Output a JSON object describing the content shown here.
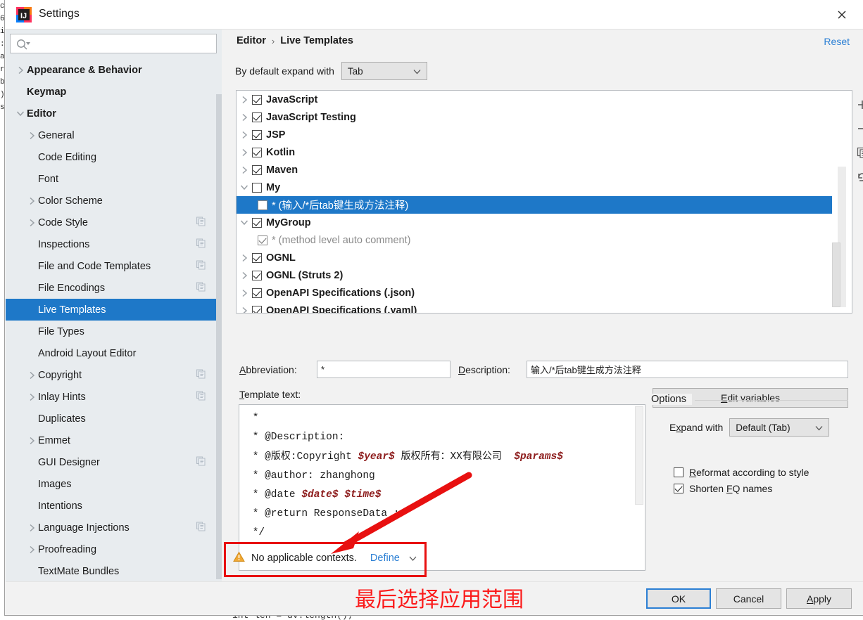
{
  "window": {
    "title": "Settings",
    "logo_icon": "intellij-idea-logo",
    "close_icon": "close-icon"
  },
  "sidebar": {
    "search": {
      "placeholder": "",
      "value": "",
      "icon": "search-icon"
    },
    "items": [
      {
        "label": "Appearance & Behavior",
        "level": 0,
        "arrow": "chevron-right",
        "selected": false,
        "copy": false
      },
      {
        "label": "Keymap",
        "level": 0,
        "arrow": "none",
        "selected": false,
        "copy": false
      },
      {
        "label": "Editor",
        "level": 0,
        "arrow": "chevron-down",
        "selected": false,
        "copy": false
      },
      {
        "label": "General",
        "level": 1,
        "arrow": "chevron-right",
        "selected": false,
        "copy": false
      },
      {
        "label": "Code Editing",
        "level": 1,
        "arrow": "none",
        "selected": false,
        "copy": false
      },
      {
        "label": "Font",
        "level": 1,
        "arrow": "none",
        "selected": false,
        "copy": false
      },
      {
        "label": "Color Scheme",
        "level": 1,
        "arrow": "chevron-right",
        "selected": false,
        "copy": false
      },
      {
        "label": "Code Style",
        "level": 1,
        "arrow": "chevron-right",
        "selected": false,
        "copy": true
      },
      {
        "label": "Inspections",
        "level": 1,
        "arrow": "none",
        "selected": false,
        "copy": true
      },
      {
        "label": "File and Code Templates",
        "level": 1,
        "arrow": "none",
        "selected": false,
        "copy": true
      },
      {
        "label": "File Encodings",
        "level": 1,
        "arrow": "none",
        "selected": false,
        "copy": true
      },
      {
        "label": "Live Templates",
        "level": 1,
        "arrow": "none",
        "selected": true,
        "copy": false
      },
      {
        "label": "File Types",
        "level": 1,
        "arrow": "none",
        "selected": false,
        "copy": false
      },
      {
        "label": "Android Layout Editor",
        "level": 1,
        "arrow": "none",
        "selected": false,
        "copy": false
      },
      {
        "label": "Copyright",
        "level": 1,
        "arrow": "chevron-right",
        "selected": false,
        "copy": true
      },
      {
        "label": "Inlay Hints",
        "level": 1,
        "arrow": "chevron-right",
        "selected": false,
        "copy": true
      },
      {
        "label": "Duplicates",
        "level": 1,
        "arrow": "none",
        "selected": false,
        "copy": false
      },
      {
        "label": "Emmet",
        "level": 1,
        "arrow": "chevron-right",
        "selected": false,
        "copy": false
      },
      {
        "label": "GUI Designer",
        "level": 1,
        "arrow": "none",
        "selected": false,
        "copy": true
      },
      {
        "label": "Images",
        "level": 1,
        "arrow": "none",
        "selected": false,
        "copy": false
      },
      {
        "label": "Intentions",
        "level": 1,
        "arrow": "none",
        "selected": false,
        "copy": false
      },
      {
        "label": "Language Injections",
        "level": 1,
        "arrow": "chevron-right",
        "selected": false,
        "copy": true
      },
      {
        "label": "Proofreading",
        "level": 1,
        "arrow": "chevron-right",
        "selected": false,
        "copy": false
      },
      {
        "label": "TextMate Bundles",
        "level": 1,
        "arrow": "none",
        "selected": false,
        "copy": false
      }
    ],
    "help_label": "?"
  },
  "content": {
    "breadcrumb": {
      "parent": "Editor",
      "separator": "›",
      "current": "Live Templates"
    },
    "reset_label": "Reset",
    "expand_row": {
      "label": "By default expand with",
      "value": "Tab"
    },
    "templates": [
      {
        "label": "JavaScript",
        "arrow": "chevron-right",
        "checked": true,
        "child": false,
        "selected": false
      },
      {
        "label": "JavaScript Testing",
        "arrow": "chevron-right",
        "checked": true,
        "child": false,
        "selected": false
      },
      {
        "label": "JSP",
        "arrow": "chevron-right",
        "checked": true,
        "child": false,
        "selected": false
      },
      {
        "label": "Kotlin",
        "arrow": "chevron-right",
        "checked": true,
        "child": false,
        "selected": false
      },
      {
        "label": "Maven",
        "arrow": "chevron-right",
        "checked": true,
        "child": false,
        "selected": false
      },
      {
        "label": "My",
        "arrow": "chevron-down",
        "checked": false,
        "child": false,
        "selected": false
      },
      {
        "label": "* (输入/*后tab键生成方法注释)",
        "arrow": "none",
        "checked": false,
        "child": true,
        "selected": true
      },
      {
        "label": "MyGroup",
        "arrow": "chevron-down",
        "checked": true,
        "child": false,
        "selected": false
      },
      {
        "label": "* (method level auto comment)",
        "arrow": "none",
        "checked": true,
        "child": true,
        "selected": false
      },
      {
        "label": "OGNL",
        "arrow": "chevron-right",
        "checked": true,
        "child": false,
        "selected": false
      },
      {
        "label": "OGNL (Struts 2)",
        "arrow": "chevron-right",
        "checked": true,
        "child": false,
        "selected": false
      },
      {
        "label": "OpenAPI Specifications (.json)",
        "arrow": "chevron-right",
        "checked": true,
        "child": false,
        "selected": false
      },
      {
        "label": "OpenAPI Specifications (.yaml)",
        "arrow": "chevron-right",
        "checked": true,
        "child": false,
        "selected": false
      }
    ],
    "tree_toolbar": [
      {
        "icon": "plus-icon",
        "label": "+"
      },
      {
        "icon": "minus-icon",
        "label": "−"
      },
      {
        "icon": "copy-icon",
        "label": "copy"
      },
      {
        "icon": "revert-icon",
        "label": "revert"
      }
    ],
    "abbreviation": {
      "label": "Abbreviation:",
      "value": "*"
    },
    "description": {
      "label": "Description:",
      "value": "输入/*后tab键生成方法注释"
    },
    "template_text_label": "Template text:",
    "template_text_lines": [
      " *",
      " * @Description:",
      " * @版权:Copyright $year$ 版权所有：XX有限公司  $params$",
      " * @author: zhanghong",
      " * @date $date$ $time$",
      " * @return ResponseData :",
      " */"
    ],
    "edit_variables_label": "Edit variables",
    "options": {
      "title": "Options",
      "expand_with": {
        "label": "Expand with",
        "value": "Default (Tab)"
      },
      "reformat": {
        "label": "Reformat according to style",
        "checked": false
      },
      "shorten": {
        "label": "Shorten FQ names",
        "checked": true
      }
    },
    "context_warning": {
      "icon": "warning-icon",
      "text": "No applicable contexts.",
      "define_label": "Define",
      "chevron": "chevron-down",
      "highlight_color": "#e81010"
    }
  },
  "annotation": {
    "text": "最后选择应用范围",
    "color": "#fb1b1b",
    "arrow_color": "#e81010"
  },
  "buttons": {
    "ok": "OK",
    "cancel": "Cancel",
    "apply": "Apply"
  },
  "backdrop": {
    "bottom_code": "int len = dv.length();"
  }
}
